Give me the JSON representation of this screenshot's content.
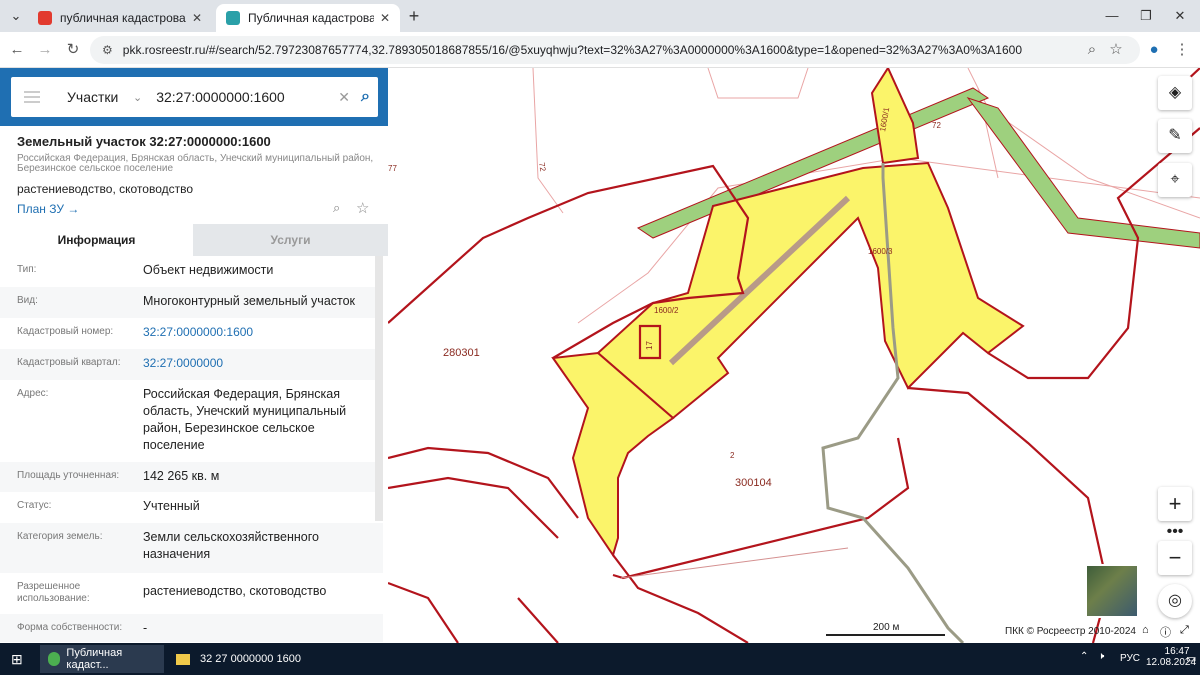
{
  "browser": {
    "tabs": [
      {
        "title": "публичная кадастровая карта",
        "favicon_color": "#e23a2e",
        "active": false
      },
      {
        "title": "Публичная кадастровая карта",
        "favicon_color": "#2aa0a8",
        "active": true
      }
    ],
    "url": "pkk.rosreestr.ru/#/search/52.79723087657774,32.789305018687855/16/@5xuyqhwju?text=32%3A27%3A0000000%3A1600&type=1&opened=32%3A27%3A0%3A1600"
  },
  "search": {
    "type_label": "Участки",
    "query": "32:27:0000000:1600"
  },
  "object": {
    "title": "Земельный участок 32:27:0000000:1600",
    "address": "Российская Федерация, Брянская область, Унечский муниципальный район, Березинское сельское поселение",
    "use": "растениеводство, скотоводство",
    "plan_label": "План ЗУ"
  },
  "tabs": {
    "info": "Информация",
    "services": "Услуги"
  },
  "info_rows": [
    {
      "key": "Тип:",
      "value": "Объект недвижимости"
    },
    {
      "key": "Вид:",
      "value": "Многоконтурный земельный участок"
    },
    {
      "key": "Кадастровый номер:",
      "value": "32:27:0000000:1600",
      "link": true
    },
    {
      "key": "Кадастровый квартал:",
      "value": "32:27:0000000",
      "link": true
    },
    {
      "key": "Адрес:",
      "value": "Российская Федерация, Брянская область, Унечский муниципальный район, Березинское сельское поселение"
    },
    {
      "key": "Площадь уточненная:",
      "value": "142 265 кв. м"
    },
    {
      "key": "Статус:",
      "value": "Учтенный"
    },
    {
      "key": "Категория земель:",
      "value": "Земли сельскохозяйственного назначения"
    },
    {
      "key": "Разрешенное использование:",
      "value": "растениеводство, скотоводство"
    },
    {
      "key": "Форма собственности:",
      "value": "-"
    }
  ],
  "map": {
    "labels": {
      "parcel_1": "1600/1",
      "parcel_2": "1600/2",
      "parcel_3": "1600/3",
      "q_280301": "280301",
      "q_300104": "300104",
      "n_77": "77",
      "n_72a": "72",
      "n_72b": "72",
      "n_17": "17",
      "n_2": "2"
    },
    "scale": "200 м",
    "copyright": "ПКК © Росреестр 2010-2024",
    "colors": {
      "parcel_fill": "#fbf46a",
      "boundary": "#b3141c",
      "road": "#7ec46a"
    }
  },
  "taskbar": {
    "items": [
      "Публичная кадаст...",
      "32 27 0000000 1600"
    ],
    "lang": "РУС",
    "time": "16:47",
    "date": "12.08.2024"
  }
}
